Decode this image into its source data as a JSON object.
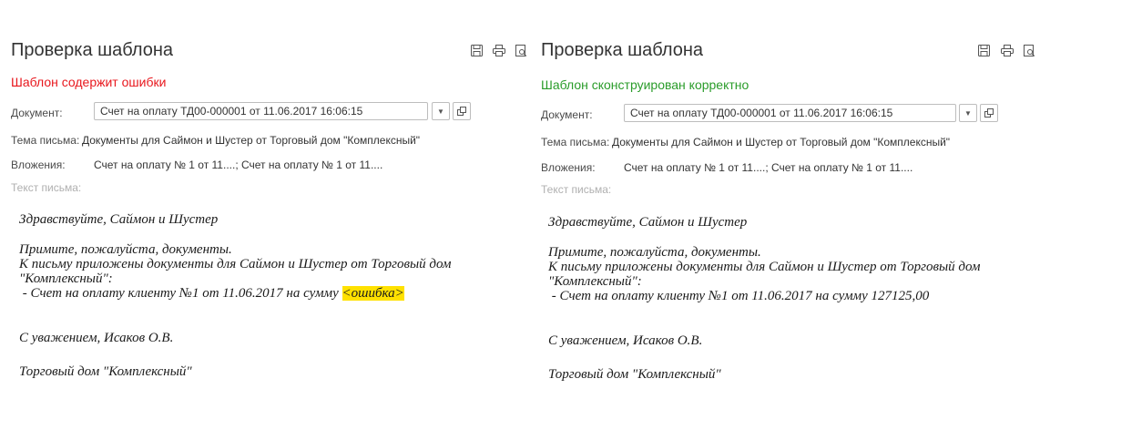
{
  "panels": [
    {
      "title": "Проверка шаблона",
      "status": "Шаблон содержит ошибки",
      "status_color": "#e8171d",
      "document_label": "Документ:",
      "document_value": "Счет на оплату ТД00-000001 от 11.06.2017 16:06:15",
      "subject_label": "Тема письма:",
      "subject_value": "Документы для Саймон и Шустер от Торговый дом \"Комплексный\"",
      "attachments_label": "Вложения:",
      "attachments_value": "Счет на оплату № 1 от 11....; Счет на оплату № 1 от 11....",
      "body_label": "Текст письма:",
      "greeting": "Здравствуйте, Саймон и Шустер",
      "line1": "Примите, пожалуйста, документы.",
      "line2": "К письму приложены документы для Саймон и Шустер от Торговый дом",
      "line3": "\"Комплексный\":",
      "line4_prefix": " - Счет на оплату клиенту №1 от 11.06.2017 на сумму ",
      "line4_value": "<ошибка>",
      "regards": "С уважением, Исаков О.В.",
      "company": "Торговый дом \"Комплексный\""
    },
    {
      "title": "Проверка шаблона",
      "status": "Шаблон сконструирован корректно",
      "status_color": "#2a9c2a",
      "document_label": "Документ:",
      "document_value": "Счет на оплату ТД00-000001 от 11.06.2017 16:06:15",
      "subject_label": "Тема письма:",
      "subject_value": "Документы для Саймон и Шустер от Торговый дом \"Комплексный\"",
      "attachments_label": "Вложения:",
      "attachments_value": "Счет на оплату № 1 от 11....; Счет на оплату № 1 от 11....",
      "body_label": "Текст письма:",
      "greeting": "Здравствуйте, Саймон и Шустер",
      "line1": "Примите, пожалуйста, документы.",
      "line2": "К письму приложены документы для Саймон и Шустер от Торговый дом",
      "line3": "\"Комплексный\":",
      "line4_prefix": " - Счет на оплату клиенту №1 от 11.06.2017 на сумму ",
      "line4_value": "127125,00",
      "regards": "С уважением, Исаков О.В.",
      "company": "Торговый дом \"Комплексный\""
    }
  ],
  "icons": [
    "save-icon",
    "print-icon",
    "preview-icon",
    "dropdown-arrow-icon",
    "open-icon"
  ]
}
